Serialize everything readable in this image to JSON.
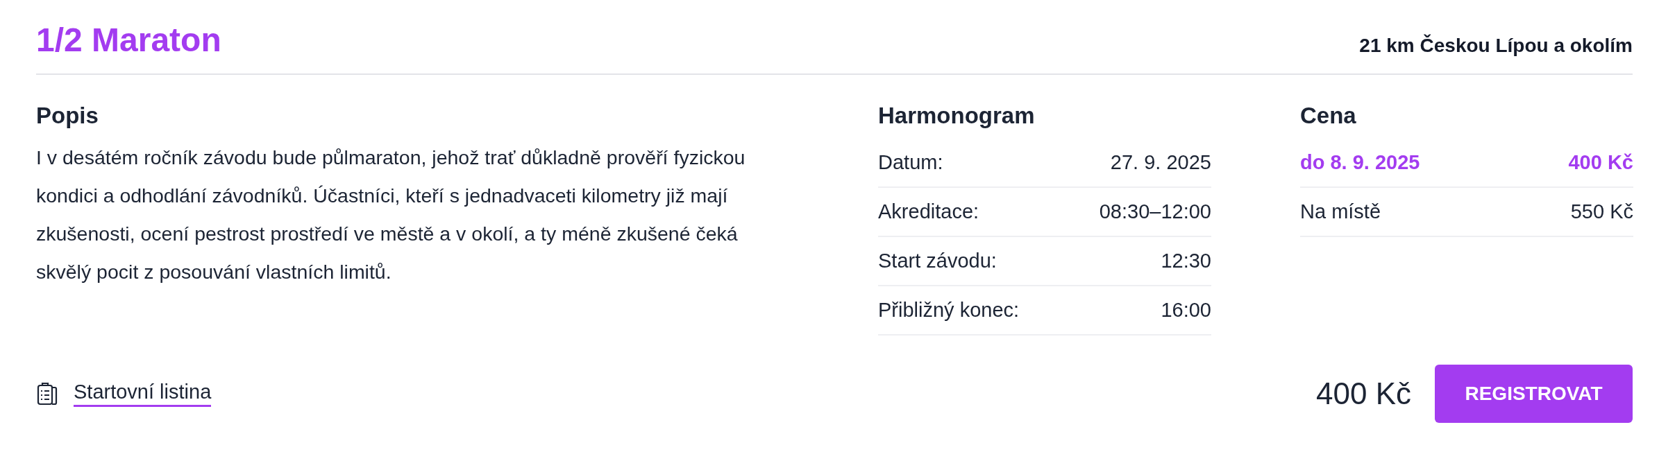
{
  "header": {
    "title": "1/2 Maraton",
    "subtitle": "21 km Českou Lípou a okolím"
  },
  "description": {
    "heading": "Popis",
    "text": "I v desátém ročník závodu bude půlmaraton, jehož trať důkladně prověří fyzickou kondici a odhodlání závodníků. Účastníci, kteří s jednadvaceti kilometry již mají zkušenosti, ocení pestrost prostředí ve městě a v okolí, a ty méně zkušené čeká skvělý pocit z posouvání vlastních limitů."
  },
  "schedule": {
    "heading": "Harmonogram",
    "rows": [
      {
        "label": "Datum:",
        "value": "27. 9. 2025",
        "highlighted": false
      },
      {
        "label": "Akreditace:",
        "value": "08:30–12:00",
        "highlighted": false
      },
      {
        "label": "Start závodu:",
        "value": "12:30",
        "highlighted": false
      },
      {
        "label": "Přibližný konec:",
        "value": "16:00",
        "highlighted": false
      }
    ]
  },
  "pricing": {
    "heading": "Cena",
    "rows": [
      {
        "label": "do 8. 9. 2025",
        "value": "400 Kč",
        "highlighted": true
      },
      {
        "label": "Na místě",
        "value": "550 Kč",
        "highlighted": false
      }
    ]
  },
  "footer": {
    "link": "Startovní listina",
    "price": "400 Kč",
    "button": "REGISTROVAT"
  }
}
